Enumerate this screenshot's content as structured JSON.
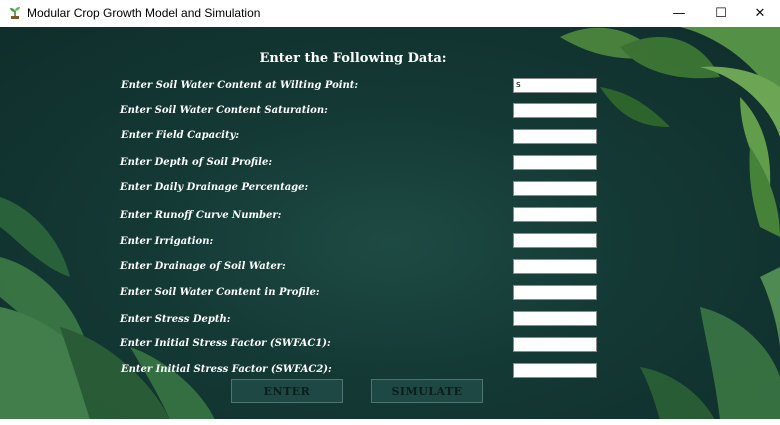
{
  "window": {
    "title": "Modular Crop Growth Model and Simulation",
    "controls": {
      "minimize": "—",
      "maximize": "☐",
      "close": "✕"
    }
  },
  "form": {
    "heading": "Enter the Following Data:",
    "fields": [
      {
        "label": "Enter Soil Water Content at Wilting Point:",
        "value": "s"
      },
      {
        "label": "Enter Soil Water Content Saturation:",
        "value": ""
      },
      {
        "label": "Enter Field Capacity:",
        "value": ""
      },
      {
        "label": "Enter Depth of Soil Profile:",
        "value": ""
      },
      {
        "label": "Enter Daily Drainage Percentage:",
        "value": ""
      },
      {
        "label": "Enter Runoff Curve Number:",
        "value": ""
      },
      {
        "label": "Enter Irrigation:",
        "value": ""
      },
      {
        "label": "Enter Drainage of Soil Water:",
        "value": ""
      },
      {
        "label": "Enter Soil Water Content in Profile:",
        "value": ""
      },
      {
        "label": "Enter Stress Depth:",
        "value": ""
      },
      {
        "label": "Enter Initial Stress Factor (SWFAC1):",
        "value": ""
      },
      {
        "label": "Enter Initial Stress Factor (SWFAC2):",
        "value": ""
      }
    ]
  },
  "buttons": {
    "enter": "ENTER",
    "simulate": "SIMULATE"
  },
  "colors": {
    "background": "#143935",
    "leaf": "#5f9a4c",
    "button": "#1d4843"
  },
  "icons": {
    "app": "seedling-icon"
  }
}
